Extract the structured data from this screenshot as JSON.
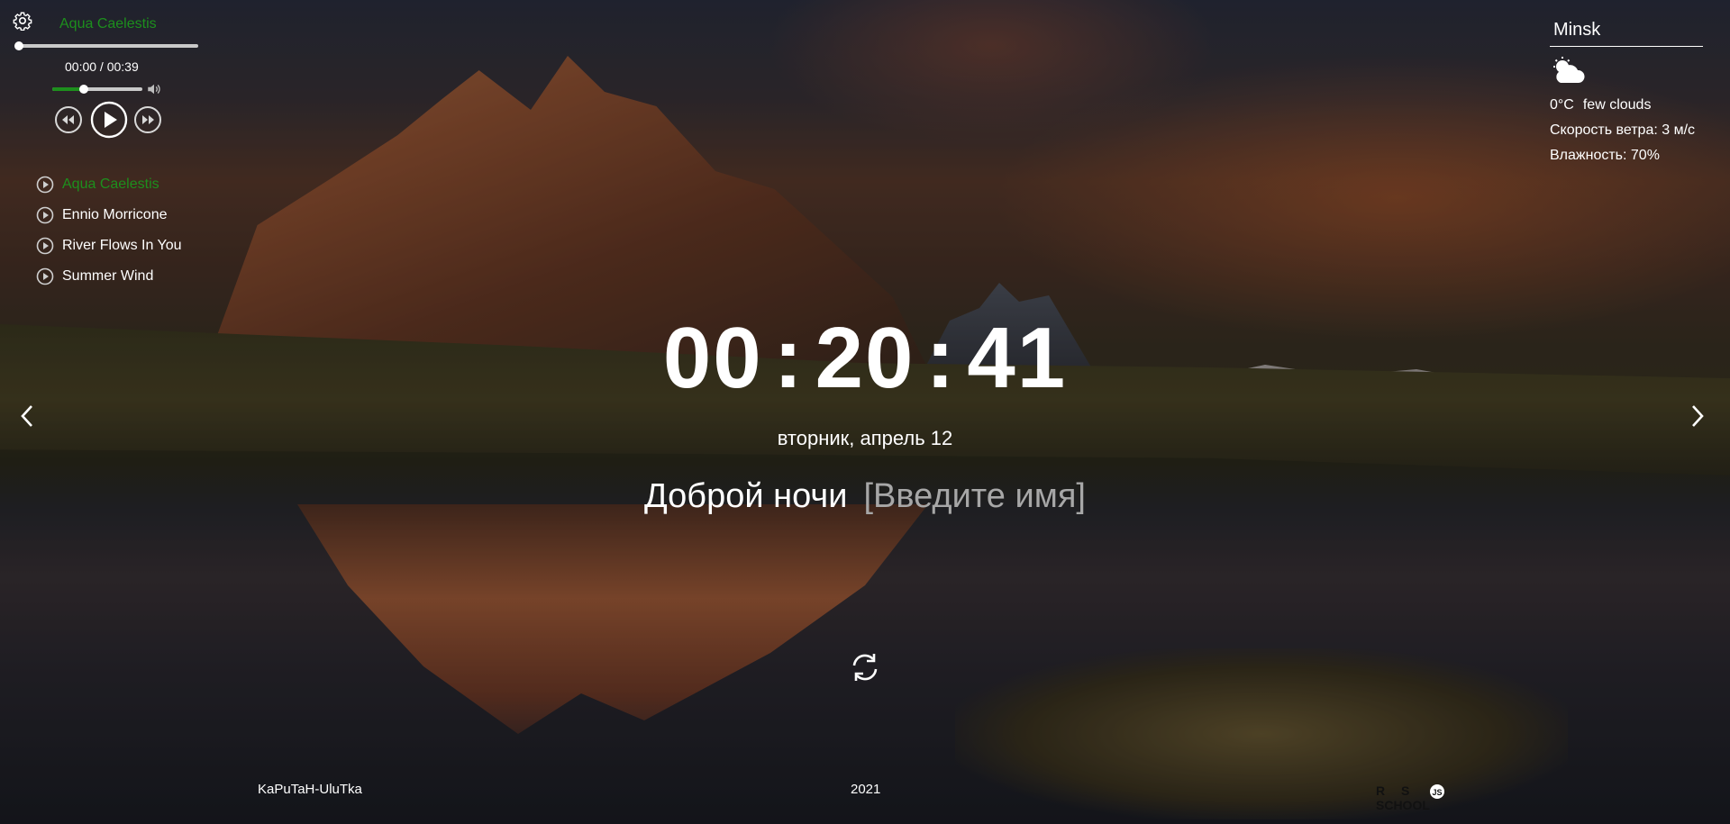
{
  "player": {
    "current_title": "Aqua Caelestis",
    "time": "00:00 / 00:39",
    "progress": 0.0,
    "volume": 0.35,
    "playlist": [
      {
        "title": "Aqua Caelestis",
        "active": true
      },
      {
        "title": "Ennio Morricone",
        "active": false
      },
      {
        "title": "River Flows In You",
        "active": false
      },
      {
        "title": "Summer Wind",
        "active": false
      }
    ]
  },
  "weather": {
    "city": "Minsk",
    "temperature": "0°C",
    "description": "few clouds",
    "wind": "Скорость ветра: 3 м/с",
    "humidity": "Влажность: 70%",
    "icon": "few-clouds-icon"
  },
  "clock": {
    "hours": "00",
    "minutes": "20",
    "seconds": "41",
    "separator": ":"
  },
  "date": "вторник, апрель 12",
  "greeting": {
    "text": "Доброй ночи",
    "name_placeholder": "[Введите имя]"
  },
  "footer": {
    "author": "KaPuTaH-UluTka",
    "year": "2021",
    "logo_text": "RS SCHOOL JS"
  },
  "colors": {
    "accent": "#1d8f1d",
    "text": "#ffffff",
    "placeholder": "#a7a7a7"
  }
}
